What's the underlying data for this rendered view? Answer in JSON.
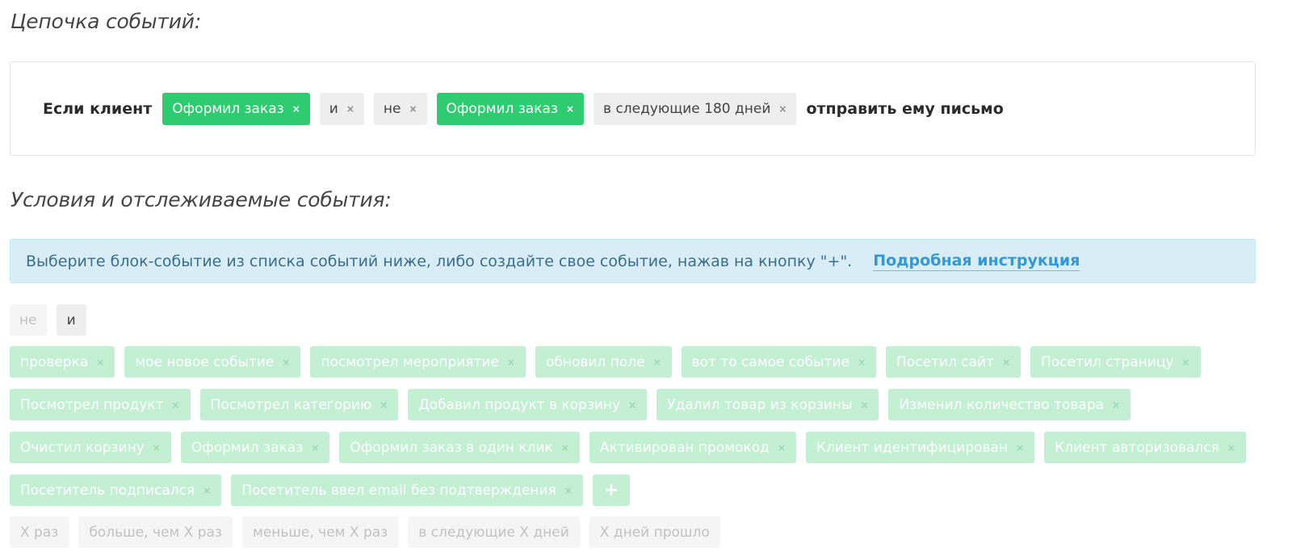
{
  "chain": {
    "title": "Цепочка событий:",
    "prefix": "Если клиент",
    "tags": [
      {
        "label": "Оформил заказ",
        "close": "×"
      },
      {
        "label": "и",
        "close": "×"
      },
      {
        "label": "не",
        "close": "×"
      },
      {
        "label": "Оформил заказ",
        "close": "×"
      },
      {
        "label": "в следующие 180 дней",
        "close": "×"
      }
    ],
    "suffix": "отправить ему письмо"
  },
  "conditions": {
    "title": "Условия и отслеживаемые события:",
    "info_text": "Выберите блок-событие из списка событий ниже, либо создайте свое событие, нажав на кнопку \"+\".",
    "info_link": "Подробная инструкция"
  },
  "operators": {
    "not_label": "не",
    "and_label": "и"
  },
  "events": [
    "проверка",
    "мое новое событие",
    "посмотрел мероприятие",
    "обновил поле",
    "вот то самое событие",
    "Посетил сайт",
    "Посетил страницу",
    "Посмотрел продукт",
    "Посмотрел категорию",
    "Добавил продукт в корзину",
    "Удалил товар из корзины",
    "Изменил количество товара",
    "Очистил корзину",
    "Оформил заказ",
    "Оформил заказ в один клик",
    "Активирован промокод",
    "Клиент идентифицирован",
    "Клиент авторизовался",
    "Посетитель подписался",
    "Посетитель ввел email без подтверждения"
  ],
  "event_close": "×",
  "add_event_label": "+",
  "frequency": [
    "X раз",
    "больше, чем X раз",
    "меньше, чем X раз",
    "в следующие X дней",
    "X дней прошло"
  ],
  "colors": {
    "green": "#2ecc71",
    "light_green": "#c3efd3",
    "info_bg": "#d9edf7",
    "link": "#3398d6"
  }
}
